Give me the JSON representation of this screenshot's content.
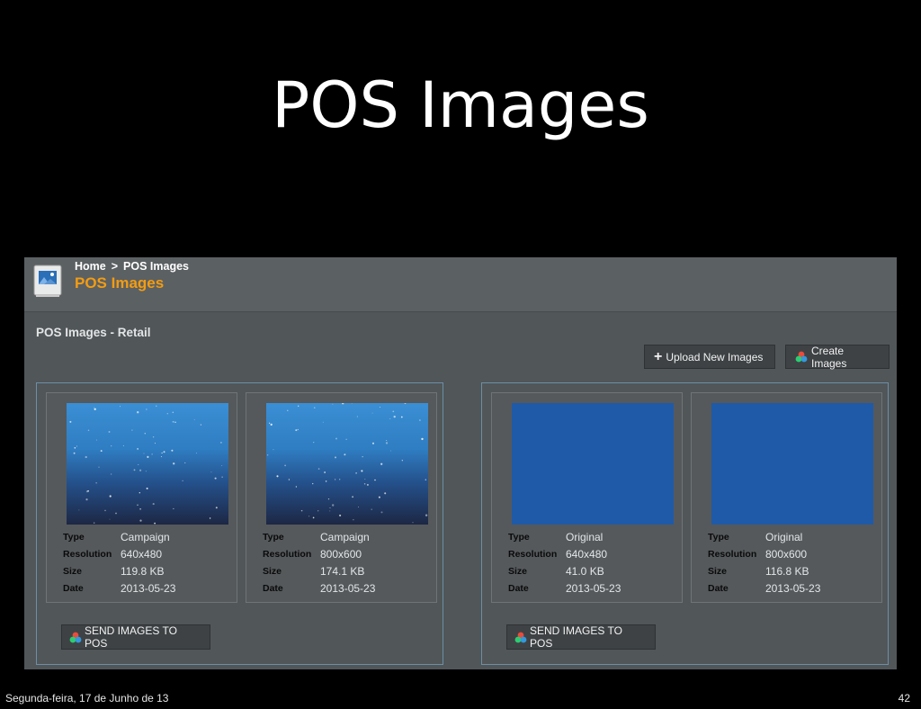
{
  "slide": {
    "title": "POS Images",
    "footer_date": "Segunda-feira, 17 de Junho de 13",
    "page_number": "42"
  },
  "header": {
    "breadcrumb": [
      "Home",
      ">",
      "POS Images"
    ],
    "title": "POS Images",
    "icon": "images-icon"
  },
  "section": {
    "title": "POS Images - Retail"
  },
  "toolbar": {
    "upload_label": "Upload New Images",
    "upload_icon": "plus-icon",
    "create_label": "Create Images",
    "create_icon": "rgb-circles-icon"
  },
  "labels": {
    "type": "Type",
    "resolution": "Resolution",
    "size": "Size",
    "date": "Date"
  },
  "groups": [
    {
      "send_label": "SEND IMAGES TO POS",
      "cards": [
        {
          "type": "Campaign",
          "resolution": "640x480",
          "size": "119.8 KB",
          "date": "2013-05-23"
        },
        {
          "type": "Campaign",
          "resolution": "800x600",
          "size": "174.1 KB",
          "date": "2013-05-23"
        }
      ]
    },
    {
      "send_label": "SEND IMAGES TO POS",
      "cards": [
        {
          "type": "Original",
          "resolution": "640x480",
          "size": "41.0 KB",
          "date": "2013-05-23"
        },
        {
          "type": "Original",
          "resolution": "800x600",
          "size": "116.8 KB",
          "date": "2013-05-23"
        }
      ]
    }
  ],
  "colors": {
    "accent_title": "#f39c12",
    "panel_bg": "#515659",
    "group_border": "#6d8fa6",
    "original_image": "#1f5aa8",
    "campaign_image_top": "#3b8fd4",
    "campaign_image_bottom": "#1d2744"
  }
}
